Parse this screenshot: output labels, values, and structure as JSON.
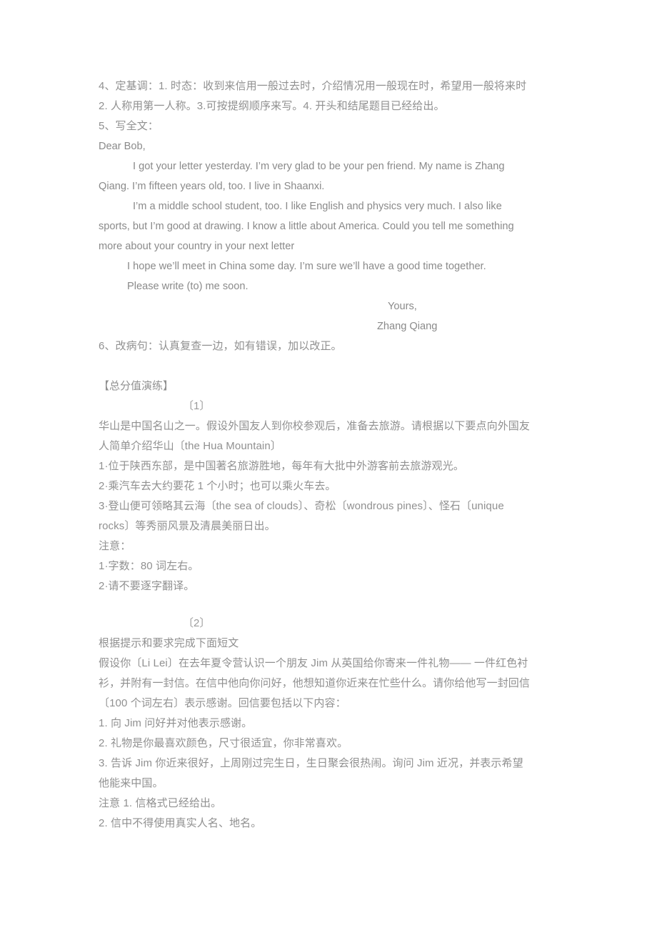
{
  "document": {
    "background_color": "#ffffff",
    "text_color": "#8d8d8d",
    "section_a": {
      "line1": "4、定基调：1. 时态：收到来信用一般过去时，介绍情况用一般现在时，希望用一般将来时",
      "line2": "2. 人称用第一人称。3.可按提纲顺序来写。4. 开头和结尾题目已经给出。",
      "line3": "5、写全文："
    },
    "letter": {
      "salutation": "Dear Bob,",
      "para1_line1": "I got your letter yesterday. I’m very glad to be your pen friend. My name is Zhang",
      "para1_line2": "Qiang. I’m fifteen years old, too. I live in Shaanxi.",
      "para2_line1": "I’m a middle school student, too. I like English and physics very much. I also like",
      "para2_line2": "sports, but I’m good at drawing. I know a little about America. Could you tell me something",
      "para2_line3": "more about your country in your next letter",
      "para3": "I hope we’ll meet in China some day. I’m sure we’ll have a good time together.",
      "para4": "Please write (to) me soon.",
      "closing": "Yours,",
      "signature": "Zhang Qiang"
    },
    "section_b": {
      "line1": "6、改病句：认真复查一边，如有错误，加以改正。"
    },
    "practice_heading": "【总分值演练】",
    "exercise1": {
      "marker": "〔1〕",
      "intro_line1": "华山是中国名山之一。假设外国友人到你校参观后，准备去旅游。请根据以下要点向外国友",
      "intro_line2": "人简单介绍华山〔the Hua Mountain〕",
      "point1": "1·位于陕西东部，是中国著名旅游胜地，每年有大批中外游客前去旅游观光。",
      "point2": "2·乘汽车去大约要花 1 个小时；也可以乘火车去。",
      "point3_line1": "3·登山便可领略其云海〔the sea of clouds〕、奇松〔wondrous pines〕、怪石〔unique",
      "point3_line2": "rocks〕等秀丽风景及清晨美丽日出。",
      "notes_label": "注意：",
      "note1": "1·字数：80 词左右。",
      "note2": "2·请不要逐字翻译。"
    },
    "exercise2": {
      "marker": "〔2〕",
      "instruction": "根据提示和要求完成下面短文",
      "body_line1": "假设你〔Li Lei〕在去年夏令营认识一个朋友 Jim 从英国给你寄来一件礼物—— 一件红色衬",
      "body_line2": "衫，并附有一封信。在信中他向你问好，他想知道你近来在忙些什么。请你给他写一封回信",
      "body_line3": "〔100 个词左右〕表示感谢。回信要包括以下内容：",
      "item1": "1. 向 Jim 问好并对他表示感谢。",
      "item2": "2. 礼物是你最喜欢颜色，尺寸很适宜，你非常喜欢。",
      "item3_line1": "3. 告诉 Jim 你近来很好，上周刚过完生日，生日聚会很热闹。询问 Jim 近况，并表示希望",
      "item3_line2": "他能来中国。",
      "note_line1": "注意 1. 信格式已经给出。",
      "note_line2": "2. 信中不得使用真实人名、地名。"
    }
  }
}
